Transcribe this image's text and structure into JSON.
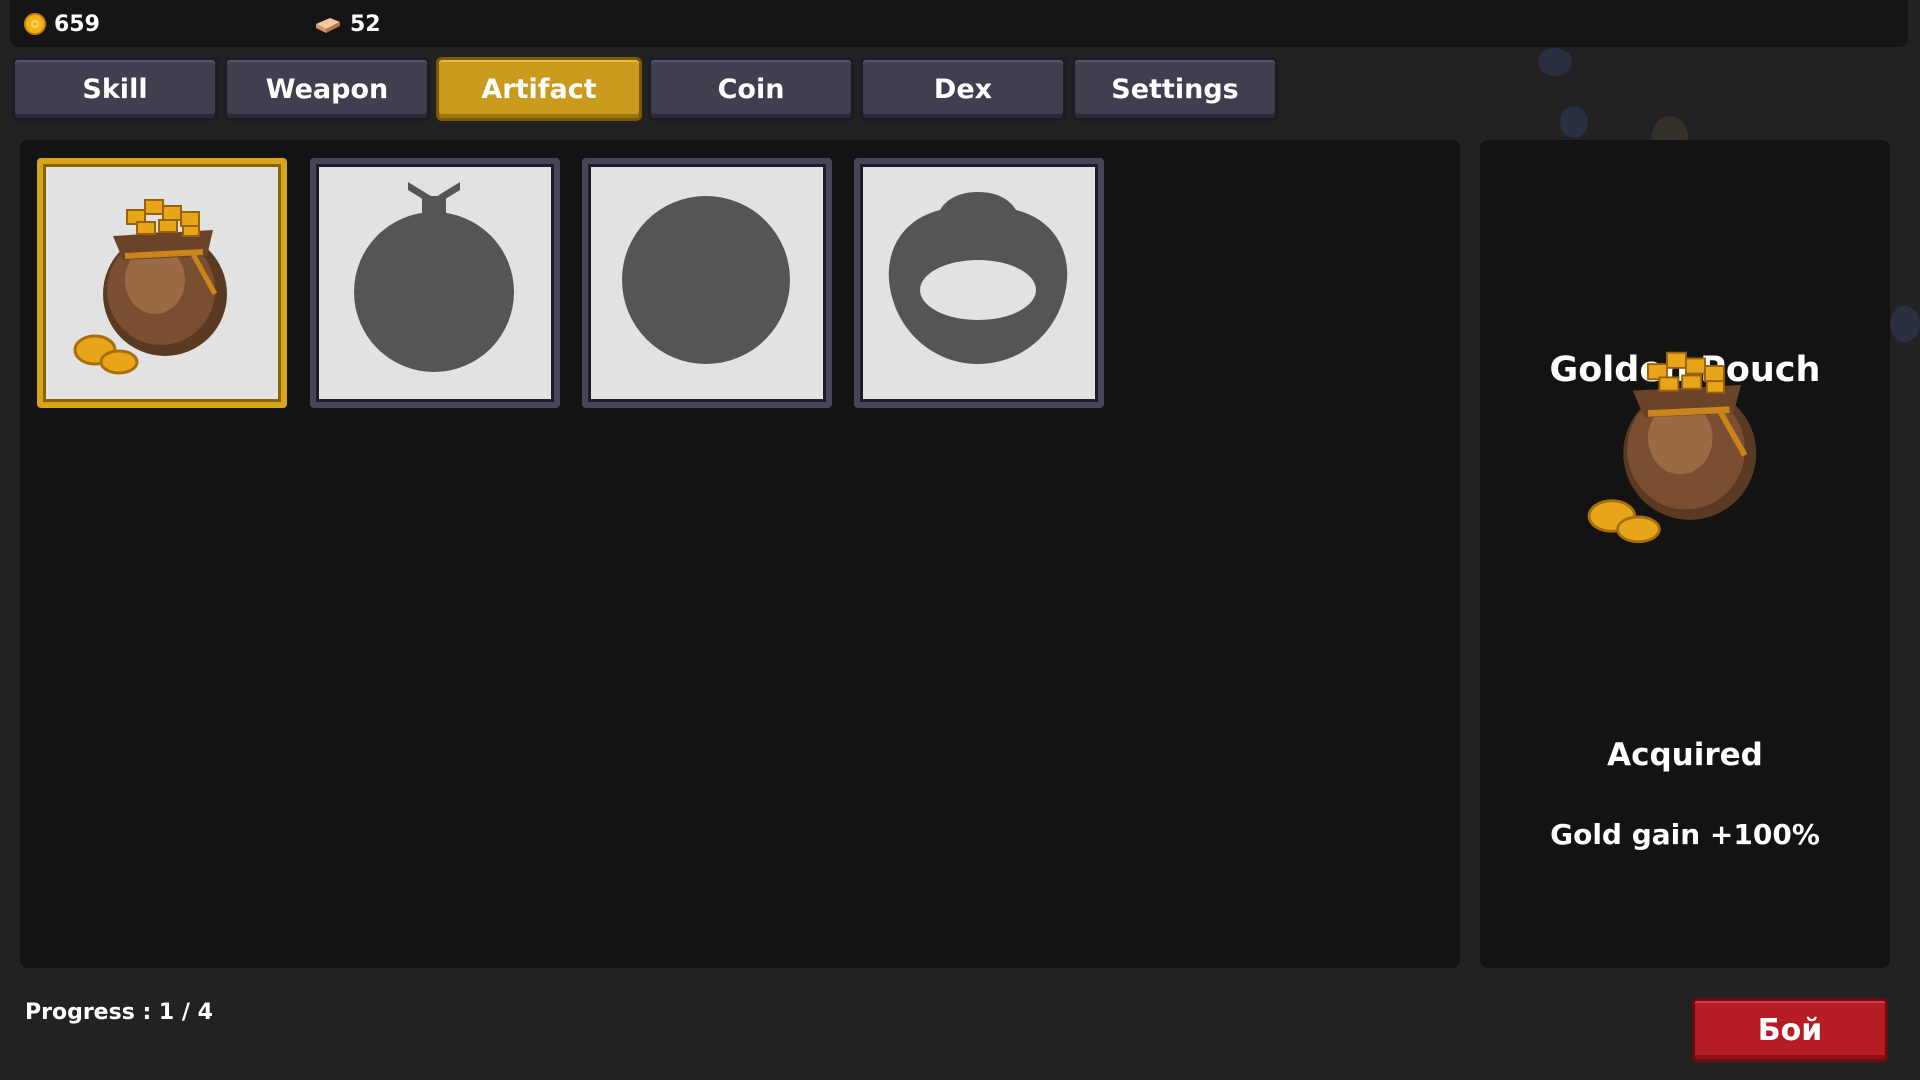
{
  "resources": {
    "coins": "659",
    "bricks": "52"
  },
  "tabs": [
    {
      "label": "Skill",
      "active": false
    },
    {
      "label": "Weapon",
      "active": false
    },
    {
      "label": "Artifact",
      "active": true
    },
    {
      "label": "Coin",
      "active": false
    },
    {
      "label": "Dex",
      "active": false
    },
    {
      "label": "Settings",
      "active": false
    }
  ],
  "artifacts": [
    {
      "icon": "golden-pouch-icon",
      "acquired": true,
      "selected": true
    },
    {
      "icon": "bomb-silhouette-icon",
      "acquired": false,
      "selected": false
    },
    {
      "icon": "orb-silhouette-icon",
      "acquired": false,
      "selected": false
    },
    {
      "icon": "ring-silhouette-icon",
      "acquired": false,
      "selected": false
    }
  ],
  "detail": {
    "title": "Golden Pouch",
    "status": "Acquired",
    "effect": "Gold gain +100%"
  },
  "progress": "Progress : 1 / 4",
  "fight_button": "Бой",
  "colors": {
    "accent_gold": "#c99a1c",
    "tab_default": "#3f3f50",
    "fight_red": "#b51c24",
    "panel": "#131313",
    "background": "#222222",
    "silhouette": "#555555"
  }
}
